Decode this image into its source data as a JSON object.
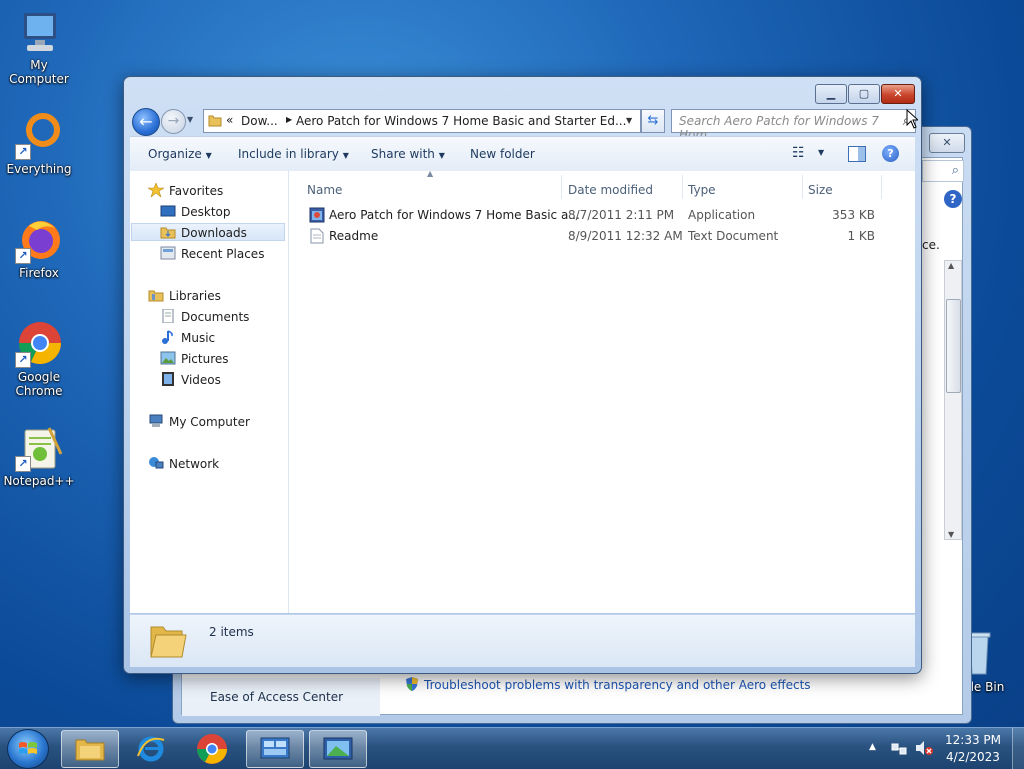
{
  "desktop": {
    "icons": [
      {
        "label": "My Computer"
      },
      {
        "label": "Everything"
      },
      {
        "label": "Firefox"
      },
      {
        "label": "Google Chrome"
      },
      {
        "label": "Notepad++"
      },
      {
        "label": "cle Bin"
      }
    ]
  },
  "background_window": {
    "partial_text": "ce.",
    "ease_link": "Ease of Access Center",
    "troubleshoot_link": "Troubleshoot problems with transparency and other Aero effects"
  },
  "explorer": {
    "breadcrumb": {
      "overflow": "«",
      "seg1": "Dow...",
      "seg2": "Aero Patch for Windows 7 Home Basic and Starter Ed..."
    },
    "search_placeholder": "Search Aero Patch for Windows 7 Hom...",
    "toolbar": {
      "organize": "Organize",
      "include": "Include in library",
      "share": "Share with",
      "new_folder": "New folder"
    },
    "nav": {
      "favorites": "Favorites",
      "desktop": "Desktop",
      "downloads": "Downloads",
      "recent": "Recent Places",
      "libraries": "Libraries",
      "documents": "Documents",
      "music": "Music",
      "pictures": "Pictures",
      "videos": "Videos",
      "computer": "My Computer",
      "network": "Network"
    },
    "columns": {
      "name": "Name",
      "date": "Date modified",
      "type": "Type",
      "size": "Size"
    },
    "files": [
      {
        "name": "Aero Patch for Windows 7 Home Basic a...",
        "date": "8/7/2011 2:11 PM",
        "type": "Application",
        "size": "353 KB"
      },
      {
        "name": "Readme",
        "date": "8/9/2011 12:32 AM",
        "type": "Text Document",
        "size": "1 KB"
      }
    ],
    "status": "2 items"
  },
  "taskbar": {
    "time": "12:33 PM",
    "date": "4/2/2023"
  }
}
